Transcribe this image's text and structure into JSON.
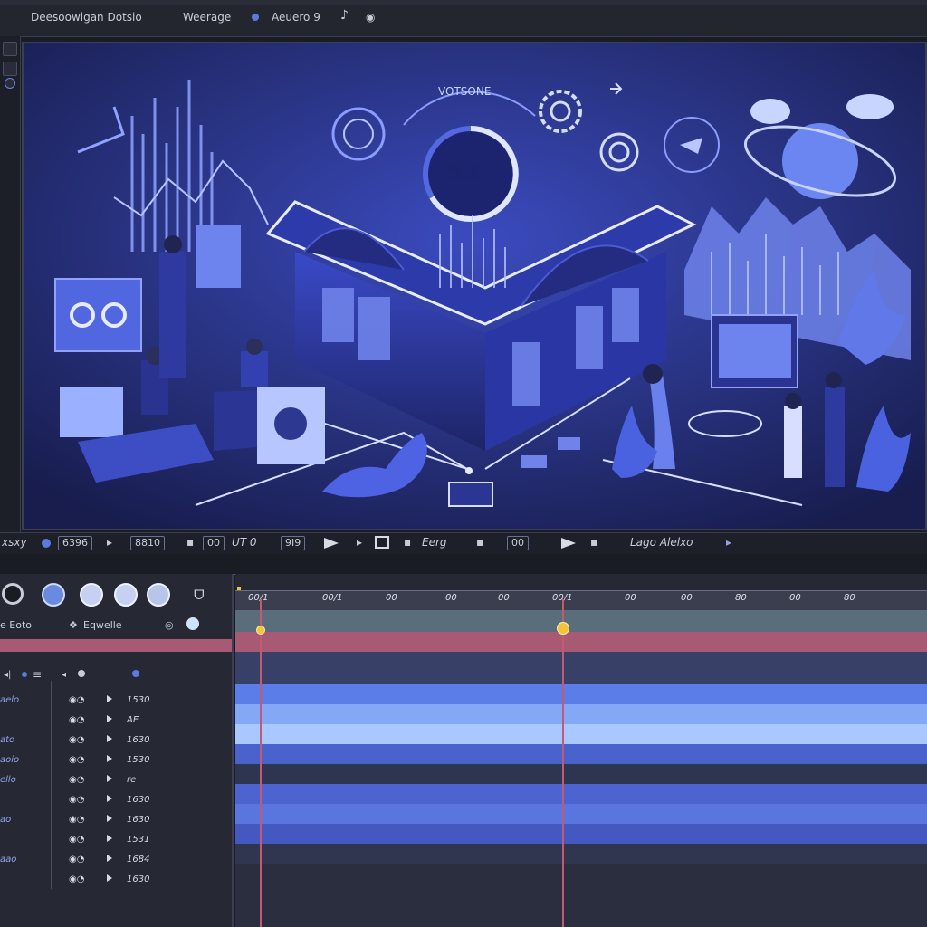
{
  "menu": {
    "items": [
      "Deesoowigan Dotsio",
      "Weerage",
      "Aeuero 9"
    ]
  },
  "viewer": {
    "badge_text": "VOTSONE",
    "gauge_value": "53."
  },
  "transport": {
    "left_label": "xsxy",
    "field1": "6396",
    "field2": "8810",
    "field3": "00",
    "field4": "UT 0",
    "field5": "9I9",
    "field6": "Eerg",
    "field7": "00",
    "right_label": "Lago Alelxo"
  },
  "layer_panel": {
    "label_a": "e Eoto",
    "label_b": "Eqwelle",
    "rows": [
      {
        "name": "aelo",
        "value": "1530"
      },
      {
        "name": "",
        "value": "AE"
      },
      {
        "name": "ato",
        "value": "1630"
      },
      {
        "name": "aoio",
        "value": "1530"
      },
      {
        "name": "ello",
        "value": "re"
      },
      {
        "name": "",
        "value": "1630"
      },
      {
        "name": "ao",
        "value": "1630"
      },
      {
        "name": "",
        "value": "1531"
      },
      {
        "name": "aao",
        "value": "1684"
      },
      {
        "name": "",
        "value": "1630"
      }
    ]
  },
  "timeline": {
    "ticks": [
      "00/1",
      "00/1",
      "00",
      "00",
      "00",
      "00/1",
      "00",
      "00",
      "80",
      "00",
      "80"
    ],
    "playhead_a_fraction": 0.035,
    "playhead_b_fraction": 0.472
  },
  "colors": {
    "accent": "#4c6be0",
    "playhead": "#f5c33b",
    "track_light": "#7aa0f0",
    "track_dark": "#4a5fc8"
  }
}
